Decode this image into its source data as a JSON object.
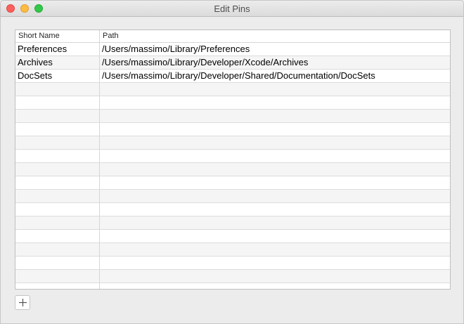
{
  "window": {
    "title": "Edit Pins"
  },
  "table": {
    "columns": [
      "Short Name",
      "Path"
    ],
    "rows": [
      {
        "name": "Preferences",
        "path": "/Users/massimo/Library/Preferences"
      },
      {
        "name": "Archives",
        "path": "/Users/massimo/Library/Developer/Xcode/Archives"
      },
      {
        "name": "DocSets",
        "path": "/Users/massimo/Library/Developer/Shared/Documentation/DocSets"
      }
    ]
  },
  "toolbar": {
    "add_icon": "plus-icon"
  },
  "colors": {
    "close": "#fc605c",
    "minimize": "#fdbc40",
    "zoom": "#34c84a",
    "row_alt": "#f5f5f5"
  }
}
